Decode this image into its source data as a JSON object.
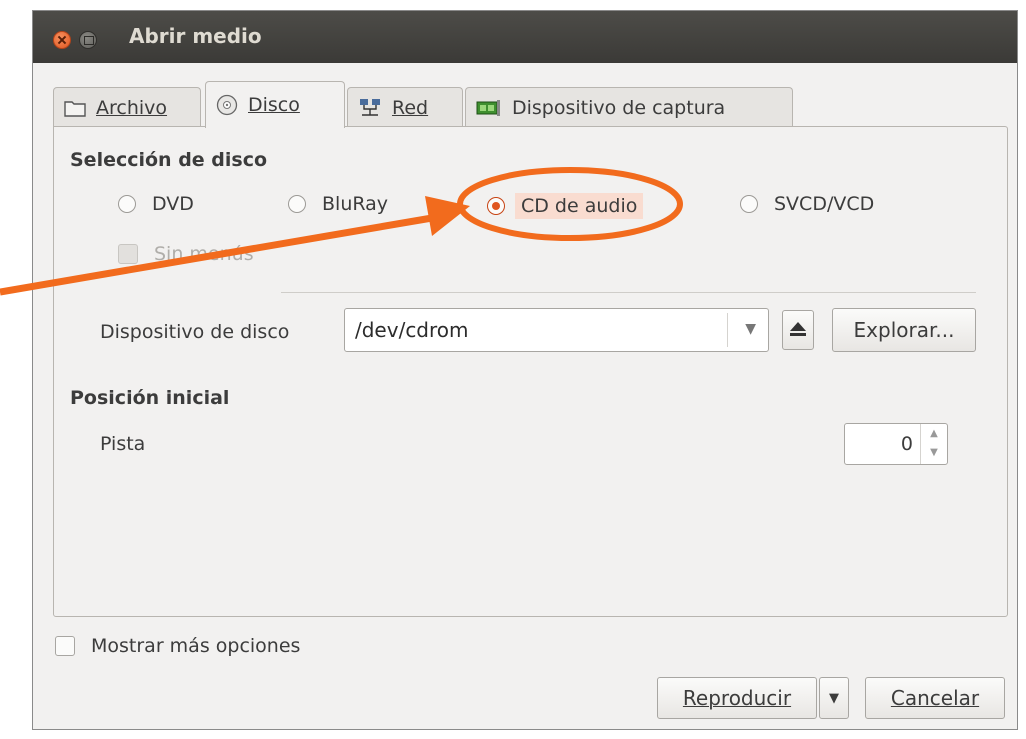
{
  "window": {
    "title": "Abrir medio"
  },
  "tabs": [
    {
      "label": "Archivo",
      "icon": "folder-icon"
    },
    {
      "label": "Disco",
      "icon": "disc-icon"
    },
    {
      "label": "Red",
      "icon": "network-icon"
    },
    {
      "label": "Dispositivo de captura",
      "icon": "capture-card-icon"
    }
  ],
  "disc_selection": {
    "title": "Selección de disco",
    "options": [
      "DVD",
      "BluRay",
      "CD de audio",
      "SVCD/VCD"
    ],
    "selected": "CD de audio",
    "no_menus_label": "Sin menús"
  },
  "device": {
    "label": "Dispositivo de disco",
    "value": "/dev/cdrom",
    "browse_label": "Explorar..."
  },
  "start_position": {
    "title": "Posición inicial",
    "track_label": "Pista",
    "track_value": "0"
  },
  "footer": {
    "more_options_label": "Mostrar más opciones",
    "play_label": "Reproducir",
    "cancel_label": "Cancelar"
  },
  "colors": {
    "annotation": "#f26b1d",
    "titlebar": "#3c3b37",
    "selected_radio": "#e0561f"
  }
}
